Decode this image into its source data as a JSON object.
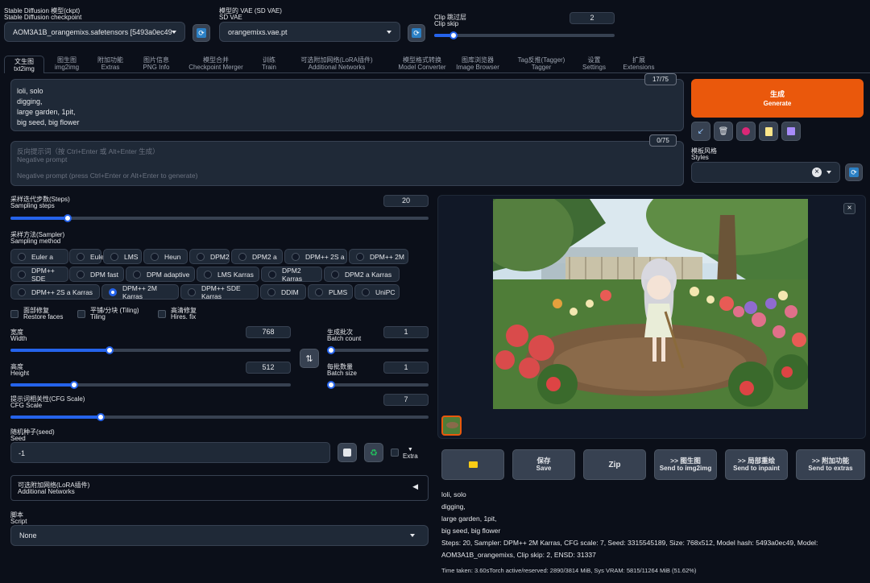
{
  "top": {
    "checkpoint_label_zh": "Stable Diffusion 模型(ckpt)",
    "checkpoint_label_en": "Stable Diffusion checkpoint",
    "checkpoint_value": "AOM3A1B_orangemixs.safetensors [5493a0ec49",
    "vae_label_zh": "模型的 VAE (SD VAE)",
    "vae_label_en": "SD VAE",
    "vae_value": "orangemixs.vae.pt",
    "clip_label_zh": "Clip 跳过层",
    "clip_label_en": "Clip skip",
    "clip_value": "2",
    "clip_level": 0.09,
    "refresh_icon": "refresh-icon"
  },
  "tabs": [
    {
      "zh": "文生图",
      "en": "txt2img"
    },
    {
      "zh": "图生图",
      "en": "img2img"
    },
    {
      "zh": "附加功能",
      "en": "Extras"
    },
    {
      "zh": "图片信息",
      "en": "PNG Info"
    },
    {
      "zh": "模型合并",
      "en": "Checkpoint Merger"
    },
    {
      "zh": "训练",
      "en": "Train"
    },
    {
      "zh": "可选附加网络(LoRA插件)",
      "en": "Additional Networks"
    },
    {
      "zh": "模型格式转换",
      "en": "Model Converter"
    },
    {
      "zh": "图库浏览器",
      "en": "Image Browser"
    },
    {
      "zh": "Tag反推(Tagger)",
      "en": "Tagger"
    },
    {
      "zh": "设置",
      "en": "Settings"
    },
    {
      "zh": "扩展",
      "en": "Extensions"
    }
  ],
  "prompt": {
    "counter": "17/75",
    "lines": [
      "loli, solo",
      "digging,",
      "large garden, 1pit,",
      "big seed, big flower"
    ]
  },
  "negative": {
    "counter": "0/75",
    "placeholder_zh": "反向提示词（按 Ctrl+Enter 或 Alt+Enter 生成）",
    "placeholder_en": "Negative prompt",
    "placeholder_long": "Negative prompt (press Ctrl+Enter or Alt+Enter to generate)"
  },
  "generate": {
    "zh": "生成",
    "en": "Generate",
    "color": "#ea580c"
  },
  "tools": [
    "arrow-diagonal-icon",
    "trash-icon",
    "palette-icon",
    "clipboard-icon",
    "save-disk-icon"
  ],
  "styles": {
    "zh": "模板风格",
    "en": "Styles",
    "clear_glyph": "×"
  },
  "sampling_steps": {
    "zh": "采样迭代步数(Steps)",
    "en": "Sampling steps",
    "value": "20",
    "level": 0.13
  },
  "sampler": {
    "zh": "采样方法(Sampler)",
    "en": "Sampling method",
    "options": [
      "Euler a",
      "Euler",
      "LMS",
      "Heun",
      "DPM2",
      "DPM2 a",
      "DPM++ 2S a",
      "DPM++ 2M",
      "DPM++ SDE",
      "DPM fast",
      "DPM adaptive",
      "LMS Karras",
      "DPM2 Karras",
      "DPM2 a Karras",
      "DPM++ 2S a Karras",
      "DPM++ 2M Karras",
      "DPM++ SDE Karras",
      "DDIM",
      "PLMS",
      "UniPC"
    ],
    "selected": "DPM++ 2M Karras"
  },
  "checks": [
    {
      "zh": "面部修复",
      "en": "Restore faces"
    },
    {
      "zh": "平铺/分块 (Tiling)",
      "en": "Tiling"
    },
    {
      "zh": "高清修复",
      "en": "Hires. fix"
    }
  ],
  "width": {
    "zh": "宽度",
    "en": "Width",
    "value": "768",
    "level": 0.35
  },
  "height": {
    "zh": "高度",
    "en": "Height",
    "value": "512",
    "level": 0.22
  },
  "swap_icon": "swap-arrows-icon",
  "batch_count": {
    "zh": "生成批次",
    "en": "Batch count",
    "value": "1",
    "level": 0.0
  },
  "batch_size": {
    "zh": "每批数量",
    "en": "Batch size",
    "value": "1",
    "level": 0.0
  },
  "cfg": {
    "zh": "提示词相关性(CFG Scale)",
    "en": "CFG Scale",
    "value": "7",
    "level": 0.21
  },
  "seed": {
    "zh": "随机种子(seed)",
    "en": "Seed",
    "value": "-1",
    "dice_icon": "dice-icon",
    "recycle_icon": "recycle-icon",
    "extra_zh": "▼",
    "extra_en": "Extra"
  },
  "addnet": {
    "zh": "可选附加网络(LoRA插件)",
    "en": "Additional Networks",
    "arrow": "◀"
  },
  "script": {
    "zh": "脚本",
    "en": "Script",
    "value": "None"
  },
  "output": {
    "close_glyph": "×",
    "buttons": [
      {
        "icon": "folder-icon",
        "zh": "",
        "en": ""
      },
      {
        "zh": "保存",
        "en": "Save"
      },
      {
        "zh": "",
        "en": "Zip"
      },
      {
        "zh": ">> 图生图",
        "en": "Send to img2img"
      },
      {
        "zh": ">> 局部重绘",
        "en": "Send to inpaint"
      },
      {
        "zh": ">> 附加功能",
        "en": "Send to extras"
      }
    ],
    "info_lines": [
      "loli, solo",
      "digging,",
      "large garden, 1pit,",
      "big seed, big flower",
      "Steps: 20, Sampler: DPM++ 2M Karras, CFG scale: 7, Seed: 3315545189, Size: 768x512, Model hash: 5493a0ec49, Model:",
      "AOM3A1B_orangemixs, Clip skip: 2, ENSD: 31337"
    ],
    "timing": "Time taken: 3.60sTorch active/reserved: 2890/3814 MiB, Sys VRAM: 5815/11264 MiB (51.62%)"
  }
}
